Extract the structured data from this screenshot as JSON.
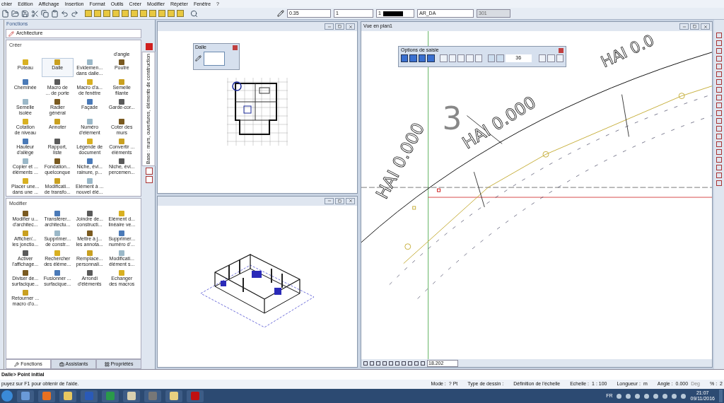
{
  "menu": [
    "chier",
    "Edition",
    "Affichage",
    "Insertion",
    "Format",
    "Outils",
    "Créer",
    "Modifier",
    "Répéter",
    "Fenêtre",
    "?"
  ],
  "toolbar": {
    "pen": "0.35",
    "line": "1",
    "ink": "1",
    "layer": "AR_DA",
    "pattern": "301"
  },
  "functions_panel": {
    "title": "Fonctions",
    "category": "Architecture",
    "side_tab": "Base : murs, ouvertures, éléments de construction",
    "sections": [
      {
        "title": "Créer",
        "fragment": "d'angle",
        "items": [
          {
            "lines": [
              "Poteau"
            ],
            "selected": false
          },
          {
            "lines": [
              "Dalle"
            ],
            "selected": true
          },
          {
            "lines": [
              "Evidemen...",
              "dans dalle..."
            ],
            "selected": false
          },
          {
            "lines": [
              "Poutre"
            ],
            "selected": false
          },
          {
            "lines": [
              "Cheminée"
            ],
            "selected": false
          },
          {
            "lines": [
              "Macro de",
              "... de porte"
            ],
            "selected": false
          },
          {
            "lines": [
              "Macro d'a...",
              "de fenêtre"
            ],
            "selected": false
          },
          {
            "lines": [
              "Semelle",
              "filante"
            ],
            "selected": false
          },
          {
            "lines": [
              "Semelle",
              "isolée"
            ],
            "selected": false
          },
          {
            "lines": [
              "Radier",
              "général"
            ],
            "selected": false
          },
          {
            "lines": [
              "Façade"
            ],
            "selected": false
          },
          {
            "lines": [
              "Garde-cor..."
            ],
            "selected": false
          },
          {
            "lines": [
              "Cotation",
              "de niveau"
            ],
            "selected": false
          },
          {
            "lines": [
              "Annoter"
            ],
            "selected": false
          },
          {
            "lines": [
              "Numéro",
              "d'élément"
            ],
            "selected": false
          },
          {
            "lines": [
              "Coter des",
              "murs"
            ],
            "selected": false
          },
          {
            "lines": [
              "Hauteur",
              "d'allège"
            ],
            "selected": false
          },
          {
            "lines": [
              "Rapport,",
              "liste"
            ],
            "selected": false
          },
          {
            "lines": [
              "Légende de",
              "document"
            ],
            "selected": false
          },
          {
            "lines": [
              "Convertir ...",
              "éléments"
            ],
            "selected": false
          },
          {
            "lines": [
              "Copier et ...",
              "éléments ..."
            ],
            "selected": false
          },
          {
            "lines": [
              "Fondation...",
              "quelconque"
            ],
            "selected": false
          },
          {
            "lines": [
              "Niche, évi...",
              "rainure, p..."
            ],
            "selected": false
          },
          {
            "lines": [
              "Niche, évi...",
              "percemen..."
            ],
            "selected": false
          },
          {
            "lines": [
              "Placer une...",
              "dans une ..."
            ],
            "selected": false
          },
          {
            "lines": [
              "Modificati...",
              "de transfo..."
            ],
            "selected": false
          },
          {
            "lines": [
              "Elément à ...",
              "nouvel élé..."
            ],
            "selected": false
          }
        ]
      },
      {
        "title": "Modifier",
        "items": [
          {
            "lines": [
              "Modifier u...",
              "d'architec..."
            ],
            "selected": false
          },
          {
            "lines": [
              "Transférer...",
              "architectu..."
            ],
            "selected": false
          },
          {
            "lines": [
              "Joindre de...",
              "constructi..."
            ],
            "selected": false
          },
          {
            "lines": [
              "Elément d...",
              "linéaire ve..."
            ],
            "selected": false
          },
          {
            "lines": [
              "Afficher/...",
              "les jonctio..."
            ],
            "selected": false
          },
          {
            "lines": [
              "Supprimer...",
              "de constr..."
            ],
            "selected": false
          },
          {
            "lines": [
              "Mettre à j...",
              "les annota..."
            ],
            "selected": false
          },
          {
            "lines": [
              "Supprimer...",
              "numéro d'..."
            ],
            "selected": false
          },
          {
            "lines": [
              "Activer",
              "l'affichage..."
            ],
            "selected": false
          },
          {
            "lines": [
              "Rechercher",
              "des éléme..."
            ],
            "selected": false
          },
          {
            "lines": [
              "Remplace...",
              "personnali..."
            ],
            "selected": false
          },
          {
            "lines": [
              "Modificati...",
              "élément s..."
            ],
            "selected": false
          },
          {
            "lines": [
              "Diviser de...",
              "surfacique..."
            ],
            "selected": false
          },
          {
            "lines": [
              "Fusionner ...",
              "surfacique..."
            ],
            "selected": false
          },
          {
            "lines": [
              "Arrondi",
              "d'éléments"
            ],
            "selected": false
          },
          {
            "lines": [
              "Echanger",
              "des macros"
            ],
            "selected": false
          },
          {
            "lines": [
              "Retourner ...",
              "macro d'o..."
            ],
            "selected": false
          }
        ]
      }
    ],
    "tabs": [
      {
        "label": "Fonctions",
        "selected": true
      },
      {
        "label": "Assistants",
        "selected": false
      },
      {
        "label": "Propriétés",
        "selected": false
      }
    ]
  },
  "dalle_dialog": {
    "title": "Dalle"
  },
  "plan_view": {
    "title": "Vue en plan1",
    "options": {
      "title": "Options de saisie",
      "value": "36"
    },
    "labels": [
      {
        "text": "3",
        "kind": "number"
      },
      {
        "text": "HAI 0.000",
        "kind": "upper"
      },
      {
        "text": "HAI 0.000",
        "kind": "lower"
      },
      {
        "text": "HAI 0.0",
        "kind": "corner"
      }
    ],
    "coordinate": "18.202"
  },
  "command_line": "Dalle> Point initial",
  "status_bar": {
    "help": "puyez sur F1 pour obtenir de l'aide.",
    "fields": [
      {
        "label": "Mode :",
        "value": "? Pt"
      },
      {
        "label": "Type de dessin :"
      },
      {
        "label": "Définition de l'échelle"
      },
      {
        "label": "Echelle :",
        "value": "1 : 100"
      },
      {
        "label": "Longueur :",
        "value": "m"
      },
      {
        "label": "Angle :",
        "value": "0.000",
        "unit": "Deg"
      },
      {
        "label": "% :",
        "value": "2"
      }
    ]
  },
  "taskbar": {
    "language": "FR",
    "time": "21:07",
    "date": "09/11/2016"
  }
}
